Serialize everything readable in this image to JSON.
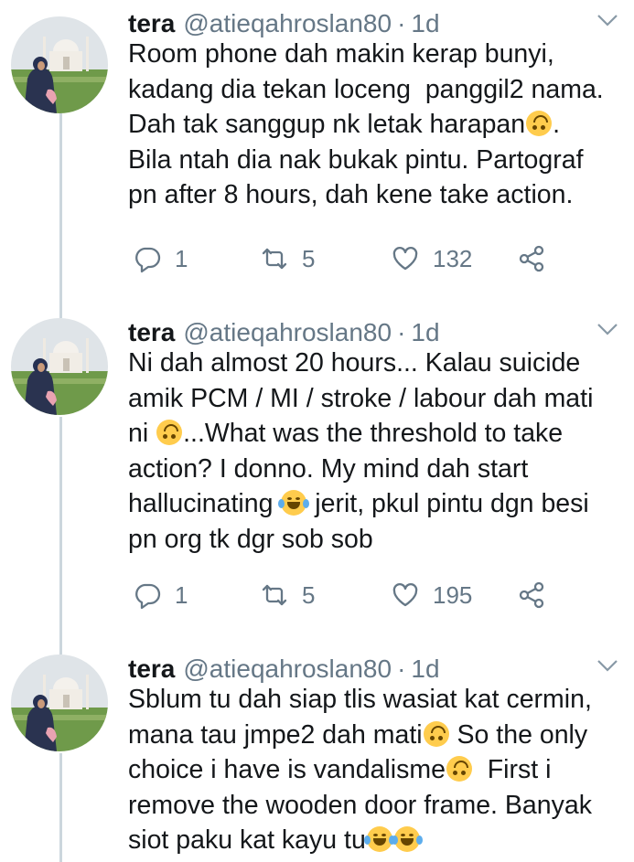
{
  "tweets": [
    {
      "name": "tera",
      "handle": "@atieqahroslan80",
      "time": "1d",
      "lines": [
        [
          {
            "t": "Room phone dah makin kerap bunyi,"
          }
        ],
        [
          {
            "t": "kadang dia tekan loceng  panggil2 nama."
          }
        ],
        [
          {
            "t": "Dah tak sanggup nk letak harapan"
          },
          {
            "e": "upside-down-face"
          },
          {
            "t": "."
          }
        ],
        [
          {
            "t": "Bila ntah dia nak bukak pintu. Partograf"
          }
        ],
        [
          {
            "t": "pn after 8 hours, dah kene take action."
          }
        ]
      ],
      "replies": "1",
      "retweets": "5",
      "likes": "132"
    },
    {
      "name": "tera",
      "handle": "@atieqahroslan80",
      "time": "1d",
      "lines": [
        [
          {
            "t": "Ni dah almost 20 hours... Kalau suicide"
          }
        ],
        [
          {
            "t": "amik PCM / MI / stroke / labour dah mati"
          }
        ],
        [
          {
            "t": "ni "
          },
          {
            "e": "upside-down-face"
          },
          {
            "t": "...What was the threshold to take"
          }
        ],
        [
          {
            "t": "action? I donno. My mind dah start"
          }
        ],
        [
          {
            "t": "hallucinating "
          },
          {
            "e": "tears-of-joy"
          },
          {
            "t": " jerit, pkul pintu dgn besi"
          }
        ],
        [
          {
            "t": "pn org tk dgr sob sob"
          }
        ]
      ],
      "replies": "1",
      "retweets": "5",
      "likes": "195"
    },
    {
      "name": "tera",
      "handle": "@atieqahroslan80",
      "time": "1d",
      "lines": [
        [
          {
            "t": "Sblum tu dah siap tlis wasiat kat cermin,"
          }
        ],
        [
          {
            "t": "mana tau jmpe2 dah mati"
          },
          {
            "e": "upside-down-face"
          },
          {
            "t": " So the only"
          }
        ],
        [
          {
            "t": "choice i have is vandalisme"
          },
          {
            "e": "upside-down-face"
          },
          {
            "t": "  First i"
          }
        ],
        [
          {
            "t": "remove the wooden door frame. Banyak"
          }
        ],
        [
          {
            "t": "siot paku kat kayu tu"
          },
          {
            "e": "tears-of-joy"
          },
          {
            "e": "tears-of-joy"
          }
        ]
      ]
    }
  ],
  "icons": {
    "reply": "reply-icon",
    "retweet": "retweet-icon",
    "like": "heart-icon",
    "share": "share-icon",
    "caret": "chevron-down-icon"
  },
  "colors": {
    "text": "#14171a",
    "secondary": "#657786",
    "thread": "#ccd6dd",
    "emoji": "#ffcc4d"
  }
}
